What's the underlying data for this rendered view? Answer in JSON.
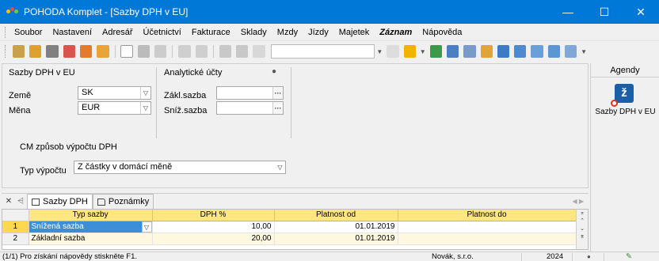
{
  "window": {
    "title": "POHODA Komplet - [Sazby DPH v EU]",
    "minimize": "—",
    "maximize": "☐",
    "close": "✕"
  },
  "menu": [
    "Soubor",
    "Nastavení",
    "Adresář",
    "Účetnictví",
    "Fakturace",
    "Sklady",
    "Mzdy",
    "Jízdy",
    "Majetek",
    "Záznam",
    "Nápověda"
  ],
  "form": {
    "section_title": "Sazby DPH v EU",
    "country_label": "Země",
    "country_value": "SK",
    "currency_label": "Měna",
    "currency_value": "EUR",
    "accounts_title": "Analytické účty",
    "basic_rate_label": "Zákl.sazba",
    "reduced_rate_label": "Sníž.sazba",
    "method_title": "CM způsob výpočtu DPH",
    "calc_type_label": "Typ výpočtu",
    "calc_type_value": "Z částky v domácí měně"
  },
  "agenda": {
    "header": "Agendy",
    "item_label": "Sazby DPH v EU"
  },
  "tabs": [
    {
      "label": "Sazby DPH",
      "active": true
    },
    {
      "label": "Poznámky",
      "active": false
    }
  ],
  "grid": {
    "columns": [
      "Typ sazby",
      "DPH %",
      "Platnost od",
      "Platnost do"
    ],
    "rows": [
      {
        "num": "1",
        "type": "Snížená sazba",
        "rate": "10,00",
        "from": "01.01.2019",
        "to": ""
      },
      {
        "num": "2",
        "type": "Základní sazba",
        "rate": "20,00",
        "from": "01.01.2019",
        "to": ""
      }
    ]
  },
  "status": {
    "help": "(1/1) Pro získání nápovědy stiskněte F1.",
    "company": "Novák, s.r.o.",
    "year": "2024"
  },
  "colors": {
    "titlebar": "#0078d7",
    "grid_header": "#ffe680",
    "selection": "#3b8fd8"
  }
}
